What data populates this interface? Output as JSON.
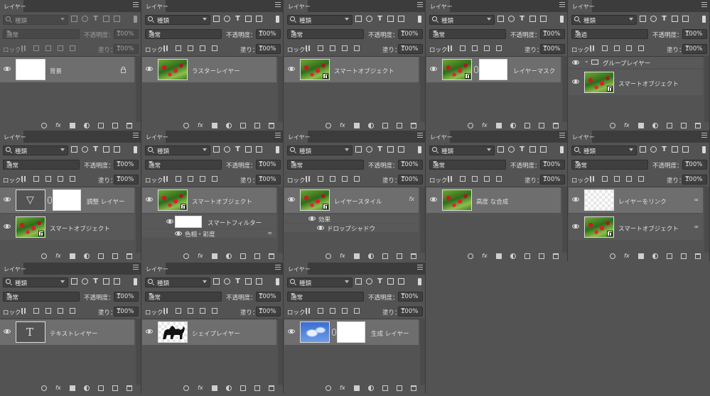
{
  "common": {
    "tab_label": "レイヤー",
    "filter_kind": "種類",
    "blend_mode": "通常",
    "opacity_label": "不透明度：",
    "opacity_value": "100%",
    "lock_label": "ロック：",
    "fill_label": "塗り：",
    "fill_value": "100%"
  },
  "panels": [
    {
      "blend_mode": "通常",
      "dim": true,
      "layers": [
        {
          "name": "背景",
          "thumb": "white",
          "locked": true,
          "selected": true
        }
      ]
    },
    {
      "blend_mode": "通常",
      "layers": [
        {
          "name": "ラスターレイヤー",
          "thumb": "photo",
          "selected": true
        }
      ]
    },
    {
      "blend_mode": "通常",
      "layers": [
        {
          "name": "スマートオブジェクト",
          "thumb": "photo",
          "smart": true,
          "selected": true
        }
      ]
    },
    {
      "blend_mode": "通常",
      "layers": [
        {
          "name": "レイヤーマスク",
          "thumb": "photo",
          "smart": true,
          "mask": true,
          "selected": true
        }
      ]
    },
    {
      "blend_mode": "通過",
      "group_name": "グループレイヤー",
      "layers": [
        {
          "name": "スマートオブジェクト",
          "thumb": "photo",
          "smart": true
        }
      ]
    },
    {
      "blend_mode": "通常",
      "layers": [
        {
          "name": "調整 レイヤー",
          "thumb": "adj",
          "mask": true,
          "selected": true
        },
        {
          "name": "スマートオブジェクト",
          "thumb": "photo",
          "smart": true
        }
      ]
    },
    {
      "blend_mode": "通常",
      "layers": [
        {
          "name": "スマートオブジェクト",
          "thumb": "photo",
          "smart": true,
          "selected": true
        }
      ],
      "filter_row": "スマートフィルター",
      "filter_item": "色相・彩度"
    },
    {
      "blend_mode": "通常",
      "layers": [
        {
          "name": "レイヤースタイル",
          "thumb": "photo",
          "smart": true,
          "selected": true,
          "fx": "fx"
        }
      ],
      "effects_label": "効果",
      "effect_item": "ドロップシャドウ"
    },
    {
      "blend_mode": "通常",
      "layers": [
        {
          "name": "高度 な合成",
          "thumb": "photo",
          "selected": true
        }
      ]
    },
    {
      "blend_mode": "通常",
      "layers": [
        {
          "name": "レイヤーをリンク",
          "thumb": "checker",
          "selected": true,
          "link": true
        },
        {
          "name": "スマートオブジェクト",
          "thumb": "photo",
          "smart": true,
          "link": true
        }
      ]
    },
    {
      "blend_mode": "通常",
      "layers": [
        {
          "name": "テキストレイヤー",
          "thumb": "text",
          "selected": true
        }
      ]
    },
    {
      "blend_mode": "通常",
      "layers": [
        {
          "name": "シェイプレイヤー",
          "thumb": "shape",
          "selected": true
        }
      ]
    },
    {
      "blend_mode": "通常",
      "layers": [
        {
          "name": "生成 レイヤー",
          "thumb": "sky",
          "mask": true,
          "selected": true
        }
      ]
    }
  ],
  "footer_icons": [
    "link-icon",
    "fx-icon",
    "mask-icon",
    "adjustment-icon",
    "folder-icon",
    "new-layer-icon",
    "trash-icon"
  ]
}
